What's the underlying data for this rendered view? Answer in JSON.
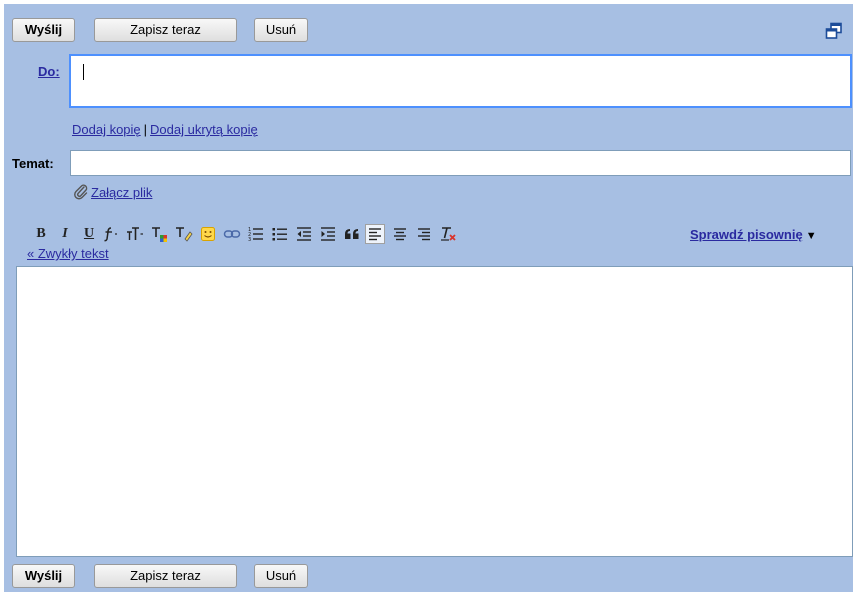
{
  "toolbar_top": {
    "send_label": "Wyślij",
    "save_label": "Zapisz teraz",
    "delete_label": "Usuń"
  },
  "toolbar_bottom": {
    "send_label": "Wyślij",
    "save_label": "Zapisz teraz",
    "delete_label": "Usuń"
  },
  "to": {
    "label": "Do:",
    "value": ""
  },
  "cc": {
    "add_cc": "Dodaj kopię",
    "separator": "|",
    "add_bcc": "Dodaj ukrytą kopię"
  },
  "subject": {
    "label": "Temat:",
    "value": ""
  },
  "attach": {
    "label": "Załącz plik"
  },
  "format": {
    "bold_glyph": "B",
    "italic_glyph": "I",
    "underline_glyph": "U",
    "plain_text_link": "« Zwykły tekst",
    "spellcheck_label": "Sprawdź pisownię",
    "spellcheck_arrow": "▼",
    "active_alignment": "left"
  },
  "body": {
    "value": ""
  },
  "colors": {
    "panel": "#a7bfe3",
    "link": "#2a2aa0",
    "focus_border": "#4d90fe"
  }
}
